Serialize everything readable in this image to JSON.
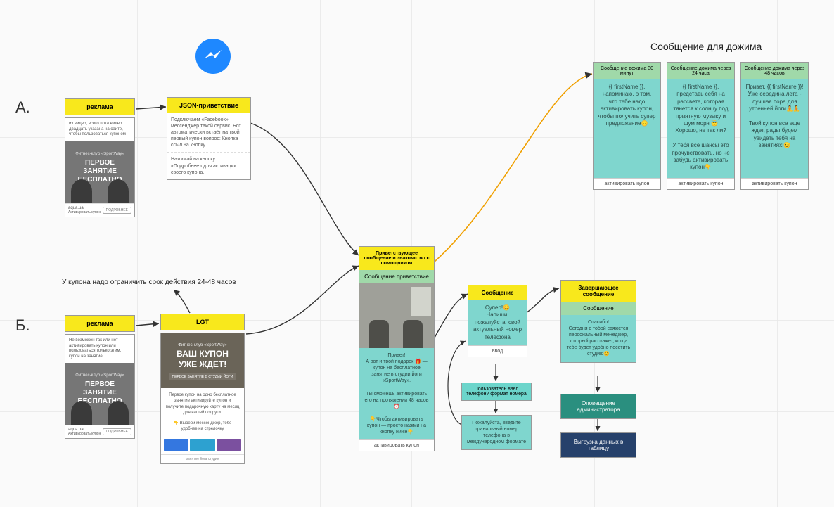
{
  "sections": {
    "a": "А.",
    "b": "Б."
  },
  "topTitle": "Сообщение для дожима",
  "couponNote": "У купона надо ограничить срок действия 24-48 часов",
  "adA": {
    "header": "реклама",
    "desc": "из видео, всего пока видео двадцать указана на сайте, чтобы пользоваться купоном",
    "promoTag": "Фитнес-клуб «SportWay»",
    "promoTitle": "ПЕРВОЕ\nЗАНЯТИЕ\nБЕСПЛАТНО",
    "site": "aqua.ua",
    "cta": "Активировать купон",
    "more": "ПОДРОБНЕЕ"
  },
  "json": {
    "header": "JSON-приветствие",
    "p1": "Подключаем «Facebook» мессенджер такой сервис. Бот автоматически встаёт на твой первый купон вопрос: Кнопка ссыл на кнопку.",
    "p2": "Нажимай на кнопку «Подробнее» для активации своего купона."
  },
  "adB": {
    "header": "реклама",
    "desc": "Не возможен так или нет активировать купон или пользоваться только этим, купон на занятие."
  },
  "lgt": {
    "header": "LGT",
    "heroTag": "Фитнес-клуб «SportWay»",
    "heroTitle": "ВАШ КУПОН\nУЖЕ ЖДЕТ!",
    "heroSub": "ПЕРВОЕ ЗАНЯТИЕ В СТУДИИ ЙОГИ",
    "p1": "Первое купон на одно бесплатное занятие активируйте купон и получите подарочную карту на месяц для вашей подруги.",
    "p2": "👇 Выбери мессенджер, тебе удобнее на стрелочку",
    "foot": "занятие йога студия"
  },
  "welcome": {
    "header": "Приветствующее сообщение и знакомство с помощником",
    "sub": "Сообщение приветствие",
    "msg": "Привет!\nА вот и твой подарок 🎁 —\nкупон на бесплатное занятие в студии йоги «SportWay».\n\nТы сможешь активировать его на протяжении 48 часов⏰\n\n👇Чтобы активировать купон — просто нажми на кнопку ниже👇",
    "btn": "активировать купон"
  },
  "msgNode": {
    "header": "Сообщение",
    "body": "Супер!😊\nНапиши, пожалуйста, свой актуальный номер телефона",
    "input": "ввод"
  },
  "err": {
    "q": "Пользователь ввел телефон? формат номера",
    "e": "Пожалуйста, введите правильный номер телефона в международном формате"
  },
  "final": {
    "header": "Завершающее сообщение",
    "sub": "Сообщение",
    "body": "Спасибо!\nСегодня с тобой свяжется персональный менеджер, который расскажет, когда тебе будет удобно посетить студию😊"
  },
  "notify": "Оповещение администратора",
  "export": "Выгрузка данных в таблицу",
  "push": [
    {
      "h": "Сообщение дожима 30 минут",
      "b": "{{ firstName }},\nнапоминаю, о том, что тебе надо активировать купон, чтобы получить супер предложение🙃",
      "btn": "активировать купон"
    },
    {
      "h": "Сообщение дожима через 24 часа",
      "b": "{{ firstName }},\nпредставь себя на рассвете, которая тянется к солнцу под приятную музыку и шум моря 😇\nХорошо, не так ли?\n\nУ тебя все шансы это прочувствовать, но не забудь активировать купон👇",
      "btn": "активировать купон"
    },
    {
      "h": "Сообщение дожима через 48 часов",
      "b": "Привет, {{ firstName }}!\nУже середина лета - лучшая пора для утренней йоги🧘🧘\n\nТвой купон все еще ждет, рады будем увидеть тебя на занятиях!😉",
      "btn": "активировать купон"
    }
  ]
}
